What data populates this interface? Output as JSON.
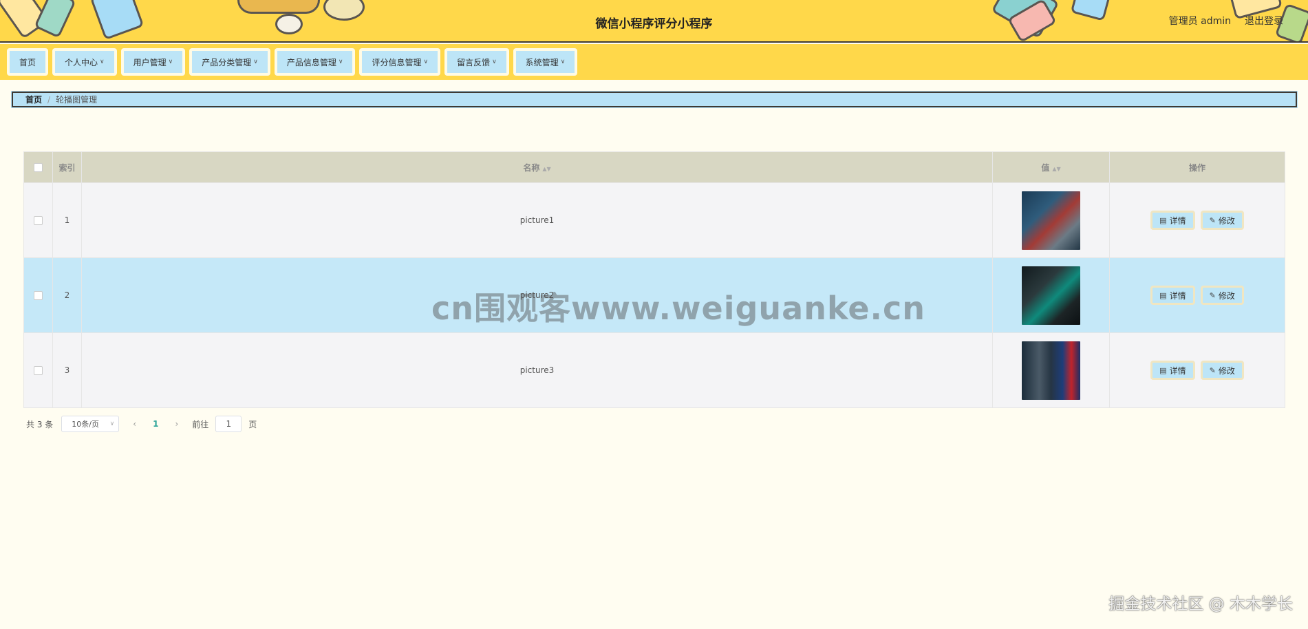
{
  "header": {
    "title": "微信小程序评分小程序",
    "user_label": "管理员 admin",
    "logout_label": "退出登录"
  },
  "nav": {
    "items": [
      {
        "label": "首页",
        "has_dropdown": false
      },
      {
        "label": "个人中心",
        "has_dropdown": true
      },
      {
        "label": "用户管理",
        "has_dropdown": true
      },
      {
        "label": "产品分类管理",
        "has_dropdown": true
      },
      {
        "label": "产品信息管理",
        "has_dropdown": true
      },
      {
        "label": "评分信息管理",
        "has_dropdown": true
      },
      {
        "label": "留言反馈",
        "has_dropdown": true
      },
      {
        "label": "系统管理",
        "has_dropdown": true
      }
    ]
  },
  "breadcrumb": {
    "home": "首页",
    "separator": "/",
    "current": "轮播图管理"
  },
  "table": {
    "columns": {
      "index": "索引",
      "name": "名称",
      "value": "值",
      "ops": "操作"
    },
    "rows": [
      {
        "index": "1",
        "name": "picture1",
        "image": "t1"
      },
      {
        "index": "2",
        "name": "picture2",
        "image": "t2",
        "highlighted": true
      },
      {
        "index": "3",
        "name": "picture3",
        "image": "t3"
      }
    ],
    "detail_label": "详情",
    "edit_label": "修改"
  },
  "pagination": {
    "total_label": "共 3 条",
    "page_size": "10条/页",
    "current_page": "1",
    "goto_prefix": "前往",
    "goto_value": "1",
    "goto_suffix": "页"
  },
  "watermarks": {
    "center": "cn围观客www.weiguanke.cn",
    "corner": "掘金技术社区 @ 木木学长"
  },
  "colors": {
    "header_bg": "#ffd84a",
    "page_bg": "#fffdf1",
    "accent_blue": "#bde5f7",
    "table_header": "#d8d7c3",
    "row_highlight": "#c5e8f8",
    "pager_active": "#2fa59a"
  }
}
